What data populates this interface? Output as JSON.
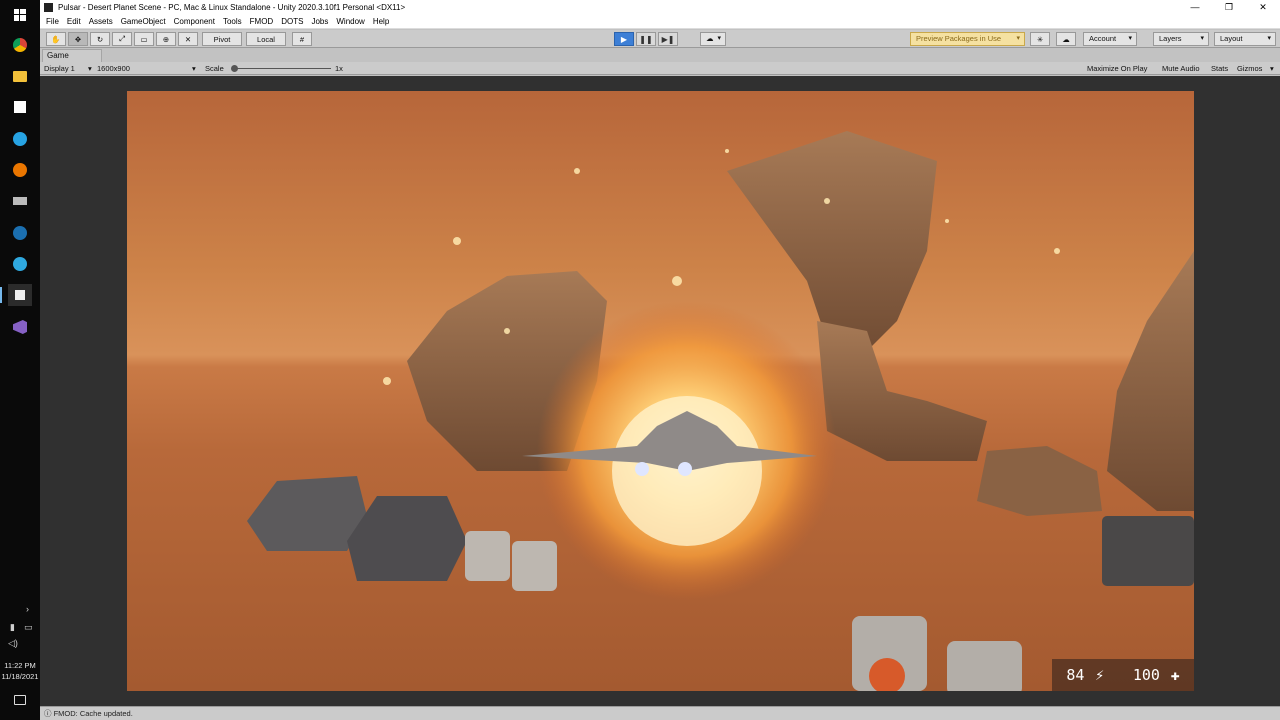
{
  "window": {
    "title": "Pulsar - Desert Planet Scene - PC, Mac & Linux Standalone - Unity 2020.3.10f1 Personal <DX11>"
  },
  "menu": [
    "File",
    "Edit",
    "Assets",
    "GameObject",
    "Component",
    "Tools",
    "FMOD",
    "DOTS",
    "Jobs",
    "Window",
    "Help"
  ],
  "toolbar": {
    "pivot": "Pivot",
    "local": "Local",
    "preview_packages": "Preview Packages in Use",
    "account": "Account",
    "layers": "Layers",
    "layout": "Layout"
  },
  "game": {
    "tab": "Game",
    "display": "Display 1",
    "resolution": "1600x900",
    "scale_label": "Scale",
    "scale_value": "1x",
    "maximize": "Maximize On Play",
    "mute": "Mute Audio",
    "stats": "Stats",
    "gizmos": "Gizmos"
  },
  "hud": {
    "energy": "84",
    "health": "100"
  },
  "status": {
    "message": "FMOD: Cache updated."
  },
  "taskbar": {
    "time": "11:22 PM",
    "date": "11/18/2021"
  }
}
